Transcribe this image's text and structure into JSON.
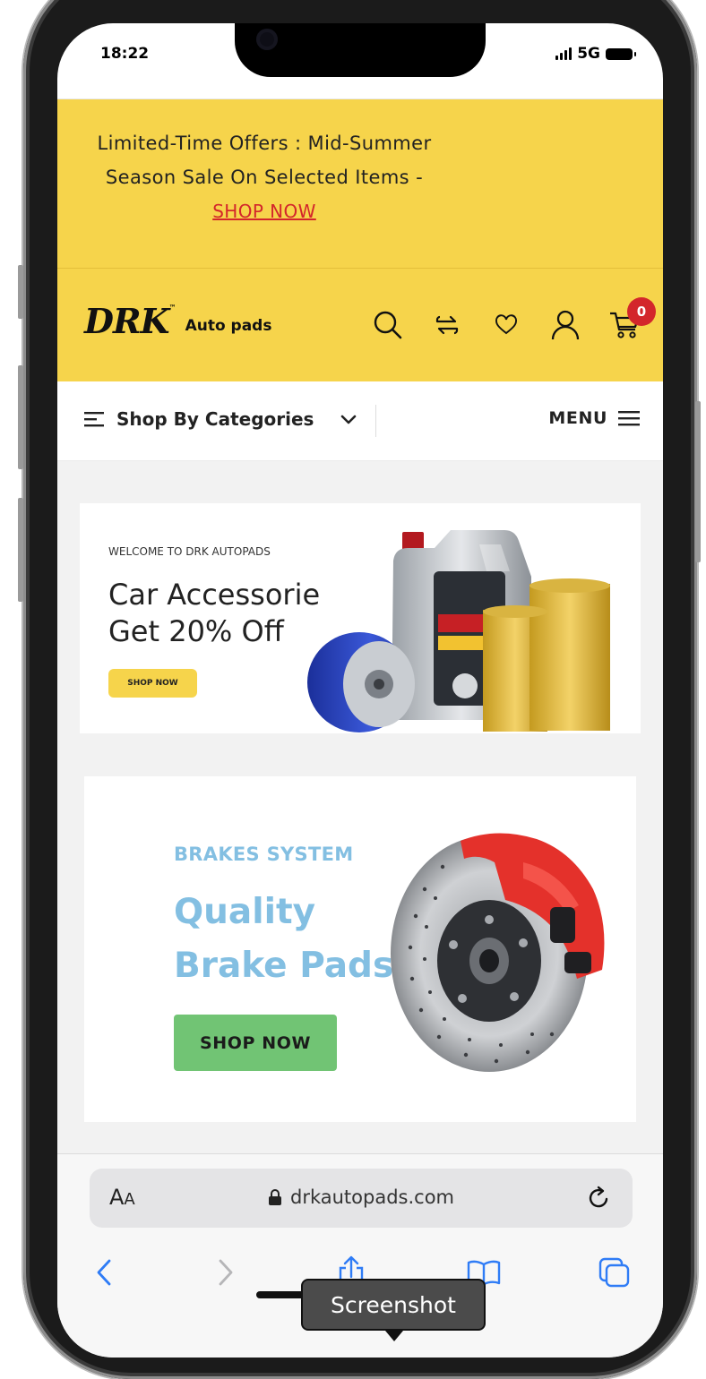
{
  "status_bar": {
    "time": "18:22",
    "network": "5G"
  },
  "promo": {
    "line1": "Limited-Time Offers : Mid-Summer",
    "line2": "Season Sale On Selected Items -",
    "link": "SHOP NOW"
  },
  "header": {
    "logo_main": "DRK",
    "logo_tm": "™",
    "logo_sub": "Auto pads",
    "cart_count": "0",
    "icons": [
      "search-icon",
      "compare-icon",
      "heart-icon",
      "user-icon",
      "cart-icon"
    ]
  },
  "category_bar": {
    "label": "Shop By Categories",
    "menu_label": "MENU"
  },
  "banner1": {
    "kicker": "WELCOME TO DRK AUTOPADS",
    "title_line1": "Car Accessorie",
    "title_line2": "Get 20% Off",
    "button": "SHOP NOW"
  },
  "banner2": {
    "kicker": "BRAKES SYSTEM",
    "title_line1": "Quality",
    "title_line2": "Brake Pads",
    "button": "SHOP NOW"
  },
  "safari": {
    "aa_label_big": "A",
    "aa_label_small": "A",
    "url": "drkautopads.com",
    "tooltip": "Screenshot"
  },
  "colors": {
    "brand_yellow": "#f6d44b",
    "promo_link_red": "#d3262b",
    "brake_blue": "#83bfe2",
    "brake_button_green": "#71c474"
  }
}
